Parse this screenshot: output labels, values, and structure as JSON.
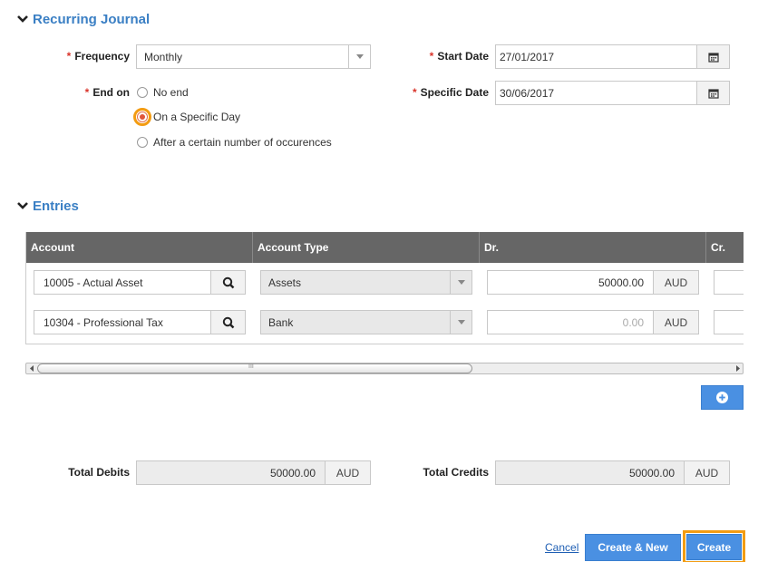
{
  "recurring": {
    "title": "Recurring Journal",
    "frequency_label": "Frequency",
    "frequency_value": "Monthly",
    "start_date_label": "Start Date",
    "start_date_value": "27/01/2017",
    "end_on_label": "End on",
    "specific_date_label": "Specific Date",
    "specific_date_value": "30/06/2017",
    "end_options": [
      {
        "label": "No end",
        "selected": false
      },
      {
        "label": "On a Specific Day",
        "selected": true
      },
      {
        "label": "After a certain number of occurences",
        "selected": false
      }
    ],
    "required_mark": "*"
  },
  "entries": {
    "title": "Entries",
    "columns": [
      "Account",
      "Account Type",
      "Dr.",
      "Cr."
    ],
    "rows": [
      {
        "account": "10005 - Actual Asset",
        "type": "Assets",
        "dr": "50000.00",
        "currency": "AUD"
      },
      {
        "account": "10304 - Professional Tax",
        "type": "Bank",
        "dr": "0.00",
        "currency": "AUD"
      }
    ]
  },
  "totals": {
    "debits_label": "Total Debits",
    "debits_value": "50000.00",
    "debits_currency": "AUD",
    "credits_label": "Total Credits",
    "credits_value": "50000.00",
    "credits_currency": "AUD"
  },
  "actions": {
    "cancel": "Cancel",
    "create_new": "Create & New",
    "create": "Create"
  },
  "scrollbar": {
    "grip": "III"
  },
  "colors": {
    "accent": "#3a7fc4",
    "button": "#4a90e2",
    "highlight": "#f39c12",
    "header": "#666666"
  }
}
